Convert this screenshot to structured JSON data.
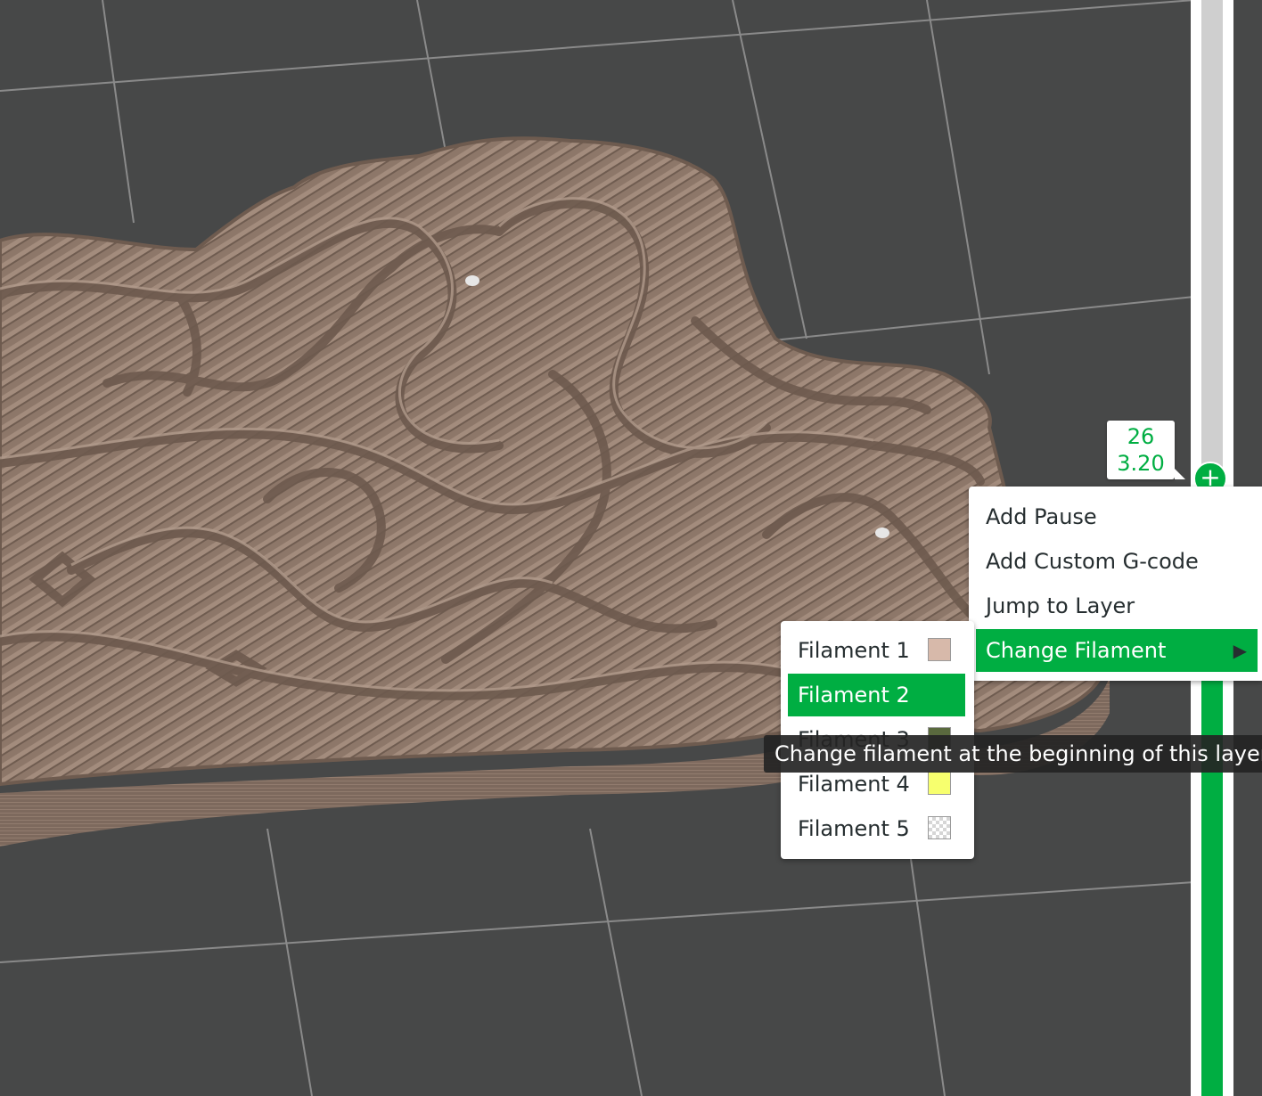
{
  "layer_slider": {
    "layer_number": "26",
    "layer_height": "3.20",
    "add_icon": "plus-icon",
    "colors": {
      "accent": "#00ae42",
      "track_upper": "#cfcfcf"
    }
  },
  "context_menu": {
    "items": [
      {
        "label": "Add Pause"
      },
      {
        "label": "Add Custom G-code"
      },
      {
        "label": "Jump to Layer"
      },
      {
        "label": "Change Filament",
        "selected": true,
        "submenu_icon": "triangle-right-icon"
      }
    ]
  },
  "filament_menu": {
    "items": [
      {
        "label": "Filament 1",
        "color": "#d7b9aa"
      },
      {
        "label": "Filament 2",
        "color": "#00ae42",
        "selected": true
      },
      {
        "label": "Filament 3",
        "color": "#5a6a3e"
      },
      {
        "label": "Filament 4",
        "color": "#f7ff6e"
      },
      {
        "label": "Filament 5",
        "color": "transparent"
      }
    ]
  },
  "tooltip": {
    "text": "Change filament at the beginning of this layer."
  },
  "scene": {
    "background": "#474848",
    "model_color": "#8c7668"
  }
}
